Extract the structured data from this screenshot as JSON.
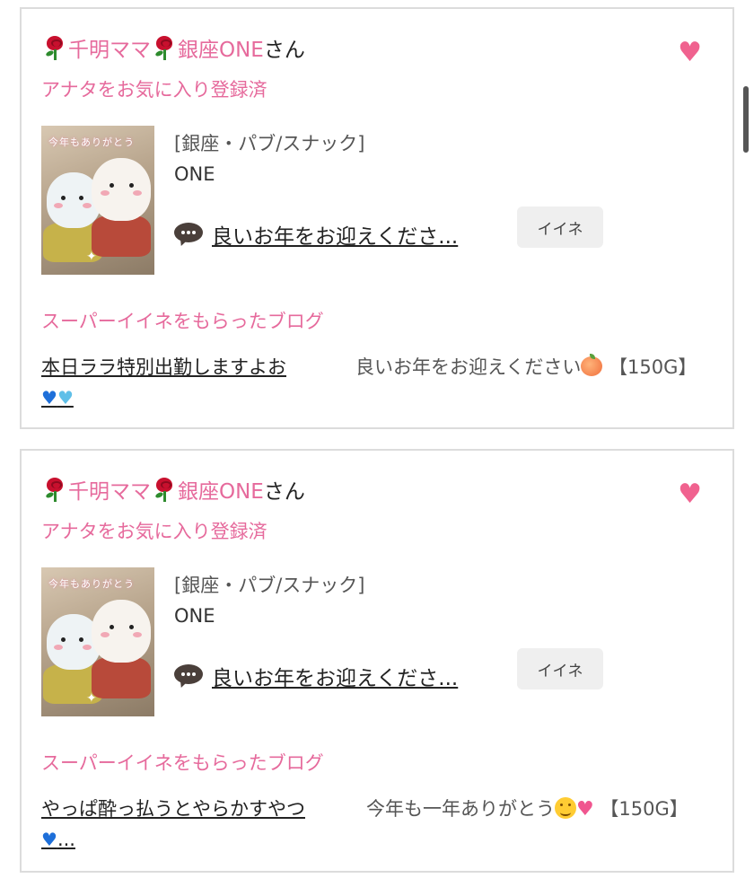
{
  "posts": [
    {
      "name_part1": "千明ママ",
      "name_part2": "銀座ONE",
      "name_suffix": "さん",
      "fav_status": "アナタをお気に入り登録済",
      "thumb_banner": "今年もありがとう",
      "category": "[銀座・パブ/スナック]",
      "shop_name": "ONE",
      "comment_link": "良いお年をお迎えくださ...",
      "iine_label": "イイネ",
      "super_heading": "スーパーイイネをもらったブログ",
      "blog_title": "本日ララ特別出勤しますよお",
      "blog_comment_text": "良いお年をお迎えください",
      "blog_comment_suffix": "【150G】"
    },
    {
      "name_part1": "千明ママ",
      "name_part2": "銀座ONE",
      "name_suffix": "さん",
      "fav_status": "アナタをお気に入り登録済",
      "thumb_banner": "今年もありがとう",
      "category": "[銀座・パブ/スナック]",
      "shop_name": "ONE",
      "comment_link": "良いお年をお迎えくださ...",
      "iine_label": "イイネ",
      "super_heading": "スーパーイイネをもらったブログ",
      "blog_title": "やっぱ酔っ払うとやらかすやつ",
      "blog_title_tail": "...",
      "blog_comment_text": "今年も一年ありがとう",
      "blog_comment_suffix": "【150G】"
    }
  ],
  "icons": {
    "rose": "rose-icon",
    "heart": "heart-icon",
    "comment": "speech-bubble-icon",
    "blue_heart": "blue-heart-icon",
    "light_blue_heart": "light-blue-heart-icon",
    "peach": "peach-icon",
    "smile": "smiling-face-icon",
    "heart_pulse": "growing-heart-icon"
  },
  "colors": {
    "accent_pink": "#e66a9c",
    "heart_pink": "#f0628f",
    "card_border": "#dcdcdc",
    "button_bg": "#efefef"
  }
}
